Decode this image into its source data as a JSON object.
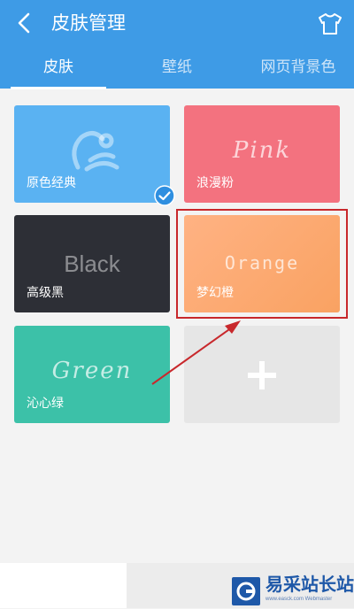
{
  "header": {
    "title": "皮肤管理",
    "back_icon": "chevron-left-icon",
    "skin_icon": "tshirt-icon",
    "accent": "#3e9be6"
  },
  "tabs": [
    {
      "label": "皮肤",
      "active": true
    },
    {
      "label": "壁纸",
      "active": false
    },
    {
      "label": "网页背景色",
      "active": false
    }
  ],
  "skins": [
    {
      "label": "原色经典",
      "art_icon": "uc-squirrel-logo",
      "color": "#5ab2f2",
      "selected": true
    },
    {
      "label": "浪漫粉",
      "art_text": "Pink",
      "color": "#f3727f",
      "selected": false
    },
    {
      "label": "高级黑",
      "art_text": "Black",
      "color": "#2d2f36",
      "selected": false
    },
    {
      "label": "梦幻橙",
      "art_text": "Orange",
      "color": "#fba96c",
      "selected": false
    },
    {
      "label": "沁心绿",
      "art_text": "Green",
      "color": "#3cc1a8",
      "selected": false
    }
  ],
  "add_card": {
    "icon": "plus-icon",
    "color": "#e6e6e6"
  },
  "annotation": {
    "color": "#c8282c"
  },
  "watermark": {
    "text": "易采站长站",
    "url": "www.easck.com Webmaster"
  }
}
